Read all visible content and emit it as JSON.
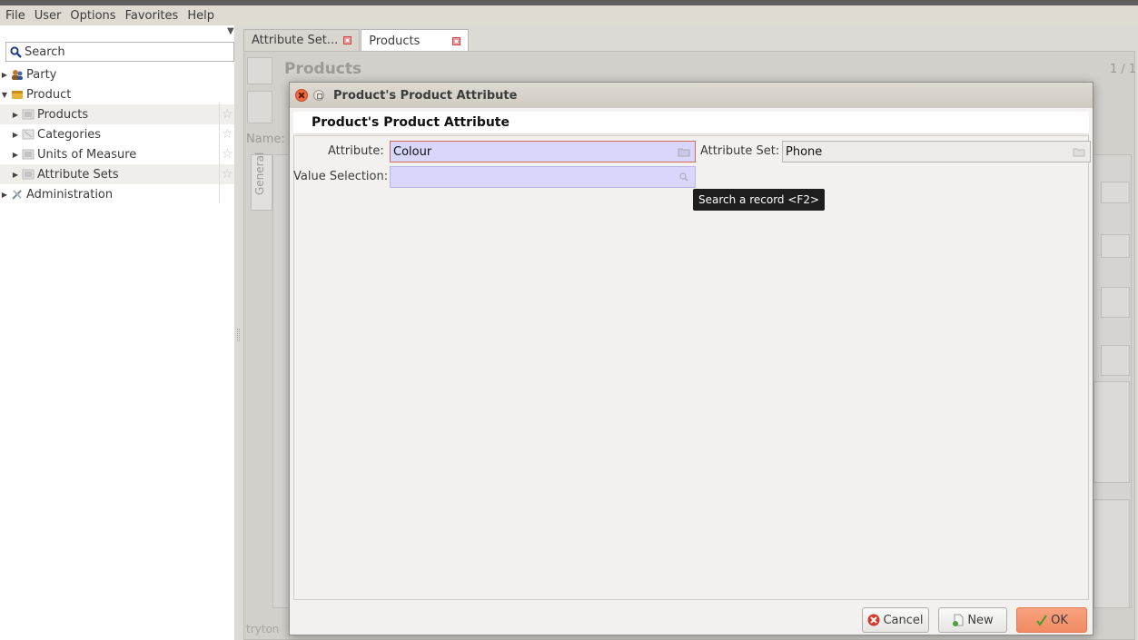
{
  "menubar": {
    "items": [
      "File",
      "User",
      "Options",
      "Favorites",
      "Help"
    ]
  },
  "sidebar": {
    "search_placeholder": "Search",
    "items": [
      {
        "label": "Party"
      },
      {
        "label": "Product"
      },
      {
        "label": "Products"
      },
      {
        "label": "Categories"
      },
      {
        "label": "Units of Measure"
      },
      {
        "label": "Attribute Sets"
      },
      {
        "label": "Administration"
      }
    ]
  },
  "tabs": [
    {
      "label": "Attribute Set..."
    },
    {
      "label": "Products"
    }
  ],
  "background_form": {
    "title": "Products",
    "page": "1 / 1",
    "name_label": "Name:",
    "tab_general": "General",
    "footer": "tryton"
  },
  "dialog": {
    "window_title": "Product's Product Attribute",
    "header": "Product's Product Attribute",
    "attribute_label": "Attribute:",
    "attribute_value": "Colour",
    "attribute_set_label": "Attribute Set:",
    "attribute_set_value": "Phone",
    "value_selection_label": "Value Selection:",
    "value_selection_value": "",
    "tooltip": "Search a record <F2>",
    "buttons": {
      "cancel": "Cancel",
      "new": "New",
      "ok": "OK"
    }
  }
}
